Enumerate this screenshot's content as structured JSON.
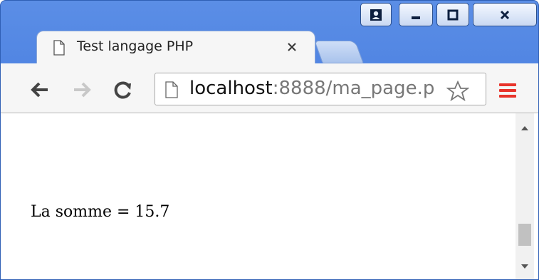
{
  "window": {
    "caption_buttons": [
      "user-icon",
      "minimize-icon",
      "maximize-icon",
      "close-icon"
    ]
  },
  "tab": {
    "title": "Test langage PHP",
    "icon": "page-icon",
    "close": "×"
  },
  "toolbar": {
    "url_host": "localhost",
    "url_rest": ":8888/ma_page.p",
    "back_icon": "back-arrow-icon",
    "forward_icon": "forward-arrow-icon",
    "reload_icon": "reload-icon",
    "star_icon": "star-icon",
    "menu_icon": "menu-icon"
  },
  "content": {
    "text": "La somme = 15.7"
  },
  "colors": {
    "chrome_blue": "#4a7fe0",
    "menu_red": "#e8342b"
  }
}
